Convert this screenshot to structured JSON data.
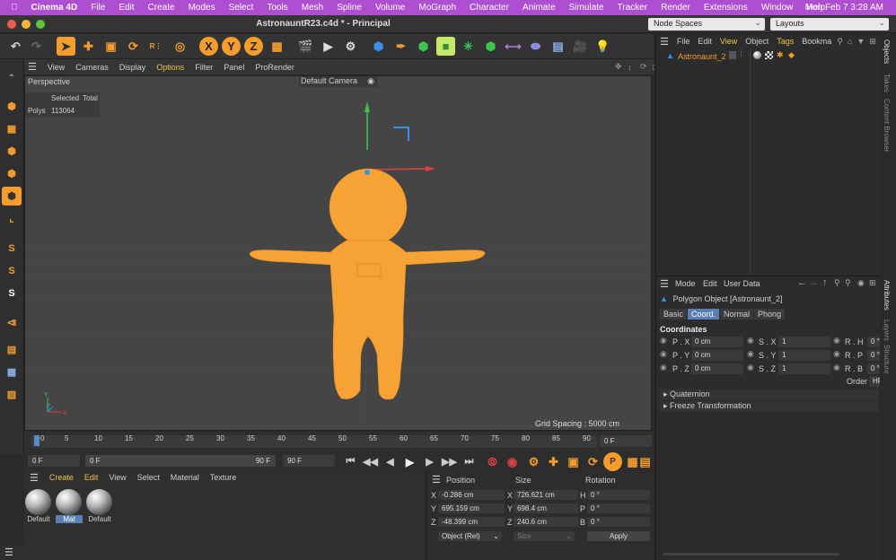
{
  "macbar": {
    "apple_icon": "apple-icon",
    "app": "Cinema 4D",
    "menus": [
      "File",
      "Edit",
      "Create",
      "Modes",
      "Select",
      "Tools",
      "Mesh",
      "Spline",
      "Volume",
      "MoGraph",
      "Character",
      "Animate",
      "Simulate",
      "Tracker",
      "Render",
      "Extensions",
      "Window",
      "Help"
    ],
    "datetime": "Mon Feb 7  3:28 AM"
  },
  "window": {
    "title": "AstronauntR23.c4d * - Principal",
    "node_spaces": "Node Spaces",
    "layouts": "Layouts"
  },
  "toolbar": {
    "axis_x": "X",
    "axis_y": "Y",
    "axis_z": "Z",
    "colors": {
      "accent": "#f49d2c",
      "axis_x": "#e04040",
      "axis_y": "#3ac54e",
      "axis_z": "#3b8fe6",
      "mac": "#ad4fd0"
    }
  },
  "viewport": {
    "menus": [
      "View",
      "Cameras",
      "Display",
      "Options",
      "Filter",
      "Panel",
      "ProRender"
    ],
    "view_name": "Perspective",
    "camera": "Default Camera",
    "stats_selected": "Selected",
    "stats_total": "Total",
    "polys_label": "Polys",
    "polys_value": "113064",
    "grid_spacing": "Grid Spacing : 5000 cm"
  },
  "timeline": {
    "ticks": [
      "0",
      "5",
      "10",
      "15",
      "20",
      "25",
      "30",
      "35",
      "40",
      "45",
      "50",
      "55",
      "60",
      "65",
      "70",
      "75",
      "80",
      "85",
      "90"
    ],
    "current_frame": "0 F"
  },
  "transport": {
    "start": "0 F",
    "range_start": "0 F",
    "range_end": "90 F",
    "end": "90 F"
  },
  "materials": {
    "menus": [
      "Create",
      "Edit",
      "View",
      "Select",
      "Material",
      "Texture"
    ],
    "items": [
      "Default",
      "Mat",
      "Default"
    ]
  },
  "coordinates": {
    "headers": [
      "Position",
      "Size",
      "Rotation"
    ],
    "rows": [
      {
        "axis": "X",
        "pos": "-0.286 cm",
        "saxis": "X",
        "size": "726.621 cm",
        "raxis": "H",
        "rot": "0 °"
      },
      {
        "axis": "Y",
        "pos": "695.159 cm",
        "saxis": "Y",
        "size": "698.4 cm",
        "raxis": "P",
        "rot": "0 °"
      },
      {
        "axis": "Z",
        "pos": "-48.399 cm",
        "saxis": "Z",
        "size": "240.6 cm",
        "raxis": "B",
        "rot": "0 °"
      }
    ],
    "mode": "Object (Rel)",
    "size_mode": "Size",
    "apply": "Apply"
  },
  "objects": {
    "menus": [
      "File",
      "Edit",
      "View",
      "Object",
      "Tags",
      "Bookma"
    ],
    "items": [
      {
        "name": "Astronaunt_2"
      }
    ]
  },
  "attributes": {
    "menus": [
      "Mode",
      "Edit",
      "User Data"
    ],
    "object": "Polygon Object [Astronaunt_2]",
    "tabs": [
      "Basic",
      "Coord.",
      "Normal",
      "Phong"
    ],
    "active_tab": "Coord.",
    "section": "Coordinates",
    "rows": [
      {
        "p": "P . X",
        "pv": "0 cm",
        "s": "S . X",
        "sv": "1",
        "r": "R . H",
        "rv": "0 °"
      },
      {
        "p": "P . Y",
        "pv": "0 cm",
        "s": "S . Y",
        "sv": "1",
        "r": "R . P",
        "rv": "0 °"
      },
      {
        "p": "P . Z",
        "pv": "0 cm",
        "s": "S . Z",
        "sv": "1",
        "r": "R . B",
        "rv": "0 °"
      }
    ],
    "order_label": "Order",
    "order_value": "HPB",
    "folds": [
      "Quaternion",
      "Freeze Transformation"
    ]
  },
  "sidetabs": [
    "Objects",
    "Takes",
    "Content Browser",
    "Attributes",
    "Layers",
    "Structure"
  ]
}
